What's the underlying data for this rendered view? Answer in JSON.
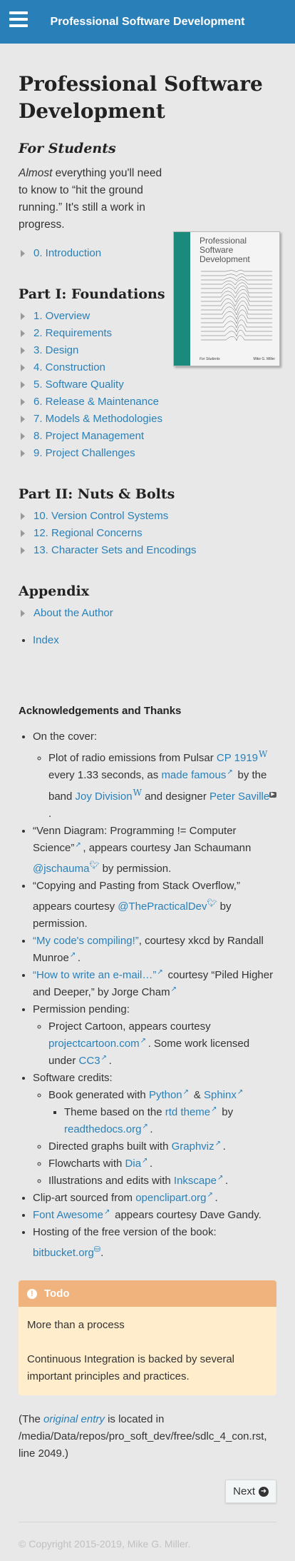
{
  "topbar": {
    "title": "Professional Software Development",
    "menu_icon": "hamburger-menu-icon"
  },
  "page": {
    "title": "Professional Software Development",
    "students_heading": "For Students",
    "intro_em": "Almost",
    "intro_rest": " everything you'll need to know to “hit the ground running.”  It's still a work in progress."
  },
  "cover": {
    "title": "Professional Software Development",
    "foot_left": "For Students",
    "foot_right": "Mike G. Miller",
    "spine_color": "#1a8a7c"
  },
  "intro_toc": {
    "label": "0.   Introduction"
  },
  "part1": {
    "heading": "Part I: Foundations",
    "items": [
      "1. Overview",
      "2. Requirements",
      "3. Design",
      "4. Construction",
      "5. Software Quality",
      "6. Release & Maintenance",
      "7. Models & Methodologies",
      "8. Project Management",
      "9. Project Challenges"
    ]
  },
  "part2": {
    "heading": "Part II: Nuts & Bolts",
    "items": [
      "10.   Version Control Systems",
      "12.   Regional Concerns",
      "13.   Character Sets and Encodings"
    ]
  },
  "appendix": {
    "heading": "Appendix",
    "about": "About the Author",
    "index": "Index"
  },
  "ack": {
    "heading": "Acknowledgements and Thanks",
    "cover_label": "On the cover:",
    "pulsar_pre": "Plot of radio emissions from Pulsar ",
    "pulsar_link": "CP 1919",
    "pulsar_mid": " every 1.33 seconds, as ",
    "made_famous": "made famous",
    "band_pre": " by the band ",
    "joy_division": "Joy Division",
    "designer_pre": " and designer ",
    "peter_saville": "Peter Saville",
    "venn_pre": "“Venn Diagram: Programming != Computer Science”",
    "venn_mid": ", appears courtesy Jan Schaumann ",
    "jschauma": "@jschauma",
    "venn_post": " by permission.",
    "copy_pre": "“Copying and Pasting from Stack Overflow,” appears courtesy ",
    "practical_dev": "@ThePracticalDev",
    "copy_post": " by permission.",
    "compiling_link": "“My code's compiling!”",
    "compiling_post": ", courtesy xkcd by Randall Munroe",
    "email_link": "“How to write an e-mail…”",
    "email_post": " courtesy “Piled Higher and Deeper,” by Jorge Cham",
    "permission_label": "Permission pending:",
    "cartoon_pre": "Project Cartoon, appears courtesy ",
    "cartoon_link": "projectcartoon.com",
    "cartoon_mid": ".  Some work licensed under ",
    "cc3": "CC3",
    "software_label": "Software credits:",
    "book_pre": "Book generated with ",
    "python": "Python",
    "amp": " & ",
    "sphinx": "Sphinx",
    "theme_pre": "Theme based on the ",
    "rtd_theme": "rtd theme",
    "theme_mid": " by ",
    "readthedocs": "readthedocs.org",
    "graphs_pre": "Directed graphs built with ",
    "graphviz": "Graphviz",
    "flow_pre": "Flowcharts with ",
    "dia": "Dia",
    "illus_pre": "Illustrations and edits with ",
    "inkscape": "Inkscape",
    "clipart_pre": "Clip-art sourced from ",
    "openclipart": "openclipart.org",
    "fontawesome": "Font Awesome",
    "fa_post": " appears courtesy Dave Gandy.",
    "hosting_pre": "Hosting of the free version of the book: ",
    "bitbucket": "bitbucket.org",
    "period": "."
  },
  "todo": {
    "title": "Todo",
    "para1": "More than a process",
    "para2": "Continuous Integration is backed by several important principles and practices.",
    "title_bg": "#f0b37e",
    "body_bg": "#ffedcc"
  },
  "original": {
    "pre": "(The ",
    "link": "original entry",
    "post": " is located in /media/Data/repos/pro_soft_dev/free/sdlc_4_con.rst, line 2049.)"
  },
  "nav": {
    "next_label": "Next"
  },
  "footer": {
    "copyright": "© Copyright 2015-2019, Mike G. Miller."
  },
  "colors": {
    "accent": "#2980b9",
    "background": "#e8e8e8"
  }
}
